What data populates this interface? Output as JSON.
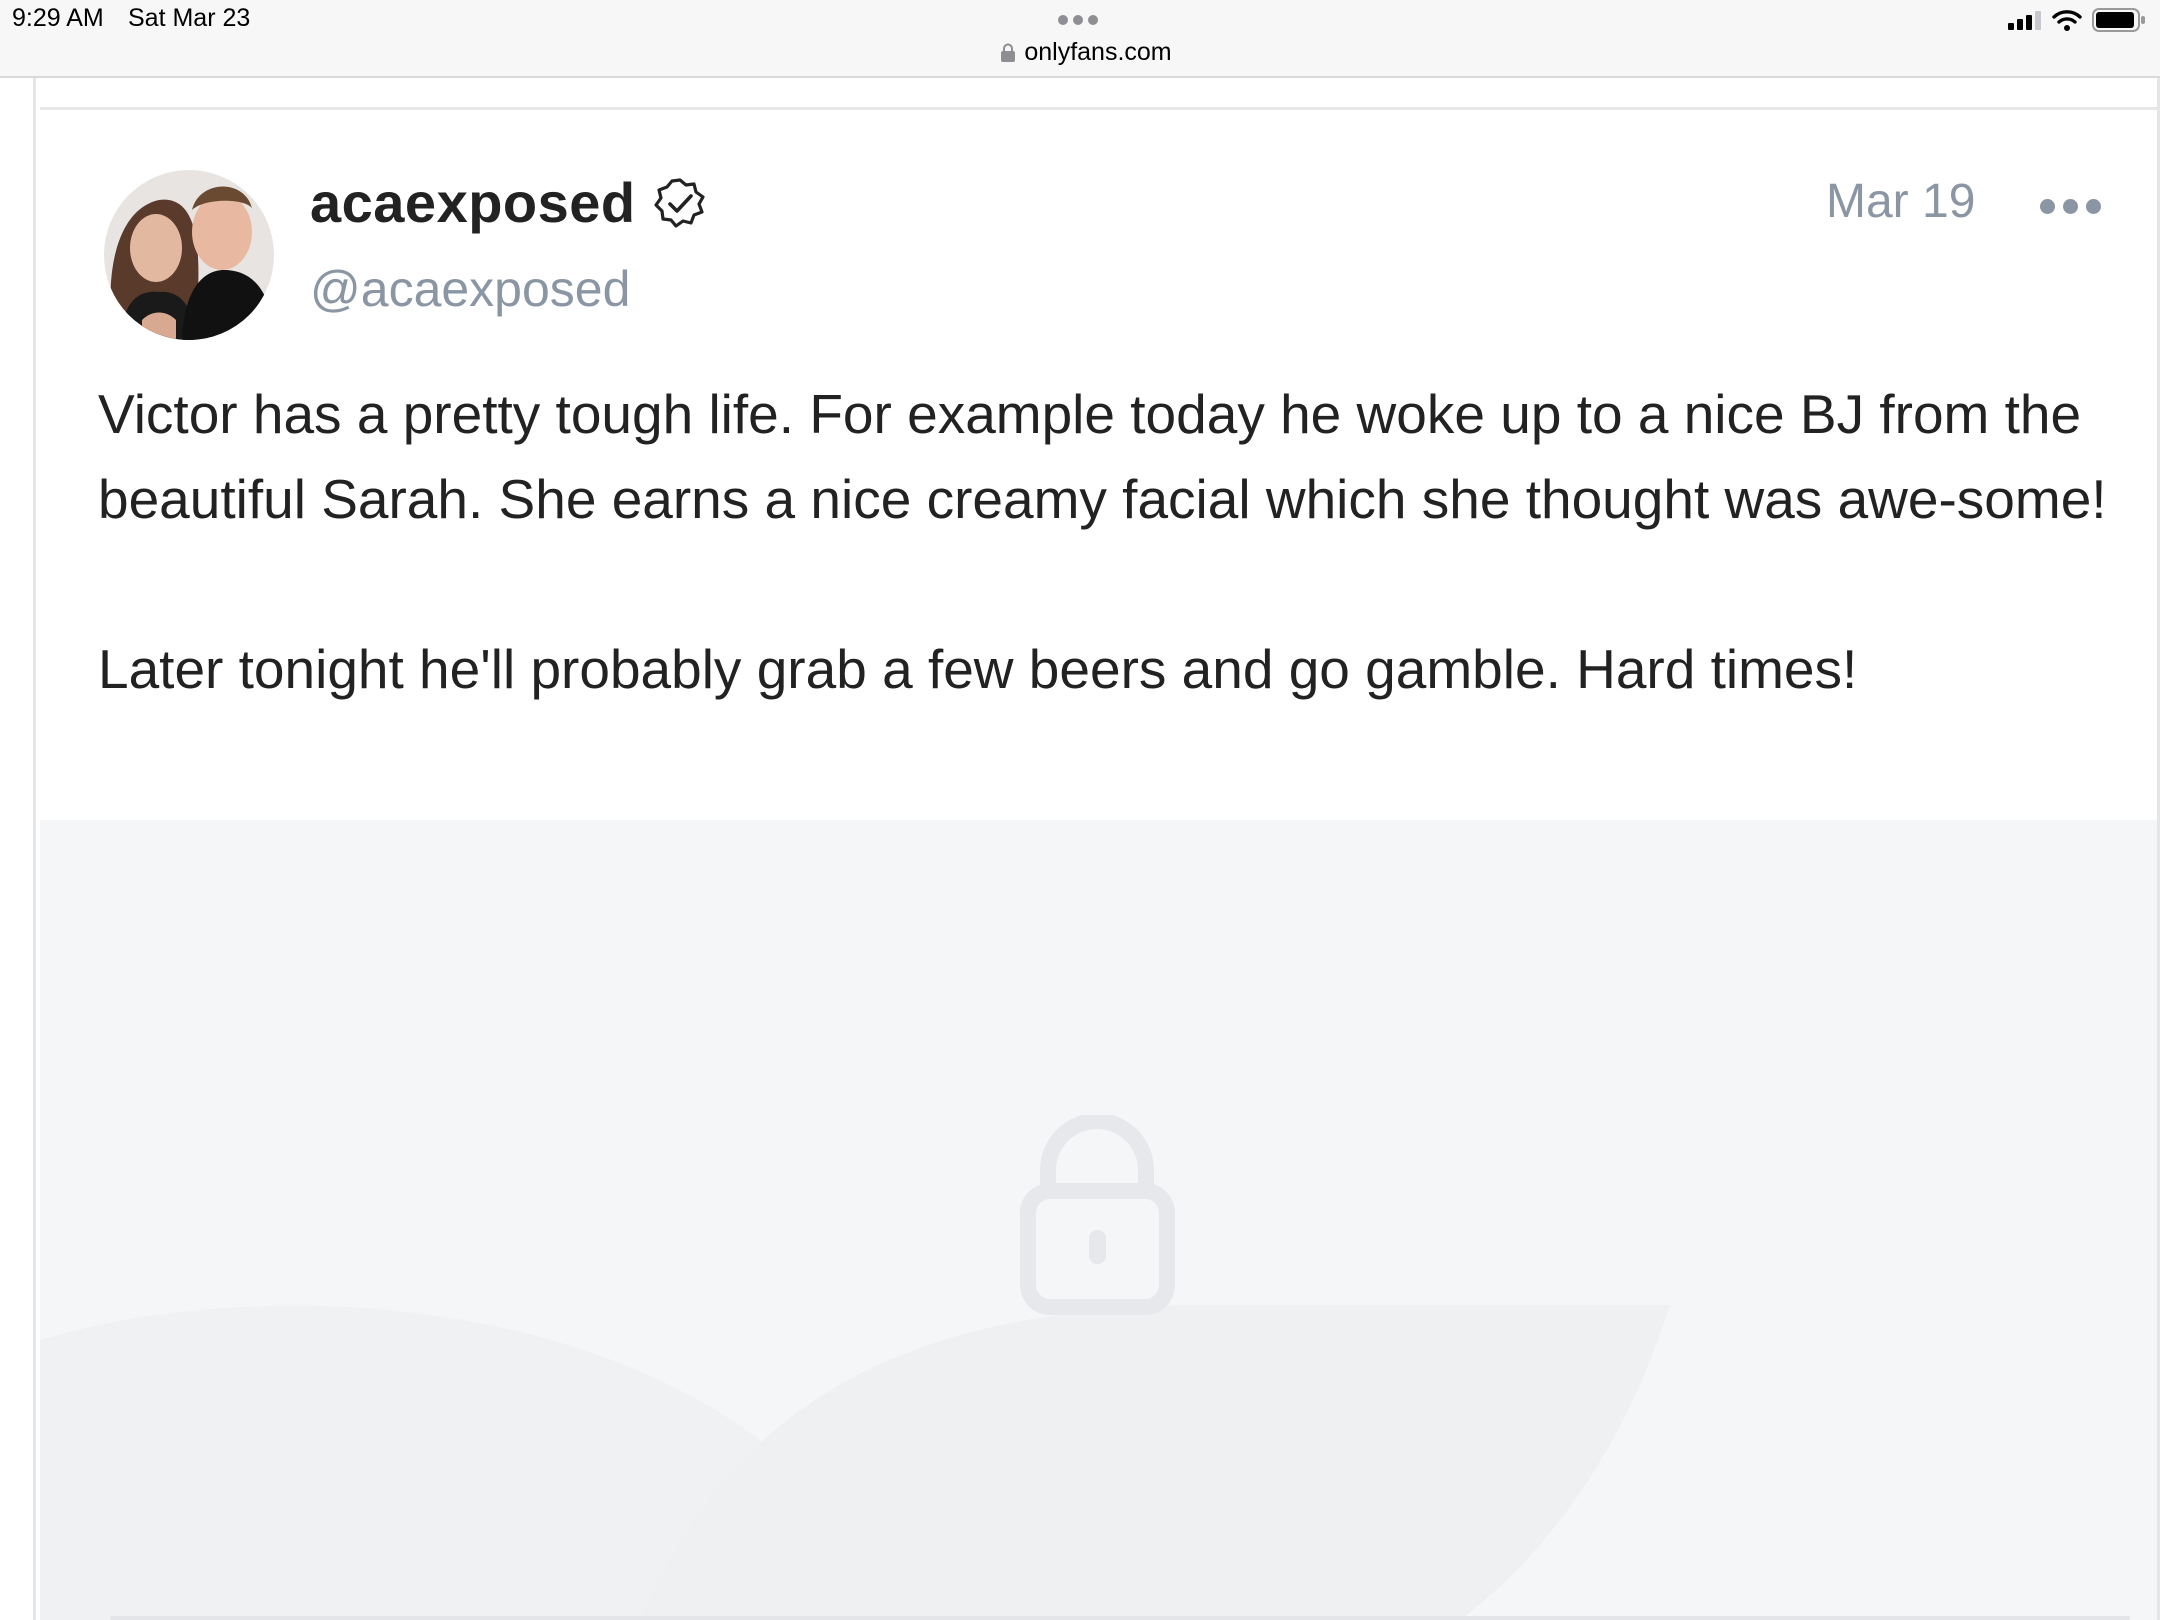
{
  "status_bar": {
    "time": "9:29 AM",
    "date": "Sat Mar 23",
    "url": "onlyfans.com"
  },
  "post": {
    "display_name": "acaexposed",
    "handle": "@acaexposed",
    "date": "Mar 19",
    "text_paragraph_1": "Victor has a pretty tough life. For example today he woke up to a nice BJ from the beautiful Sarah. She earns a nice creamy facial which she thought was awe-some!",
    "text_paragraph_2": "Later tonight he'll probably grab a few beers and go gamble. Hard times!"
  },
  "icons": {
    "verified": "verified-badge-icon",
    "more": "more-options-icon",
    "lock": "lock-icon",
    "tabs": "tabs-overview-icon"
  },
  "colors": {
    "muted_text": "#8a96a3",
    "body_text": "#222222",
    "locked_bg": "#f5f6f8"
  }
}
